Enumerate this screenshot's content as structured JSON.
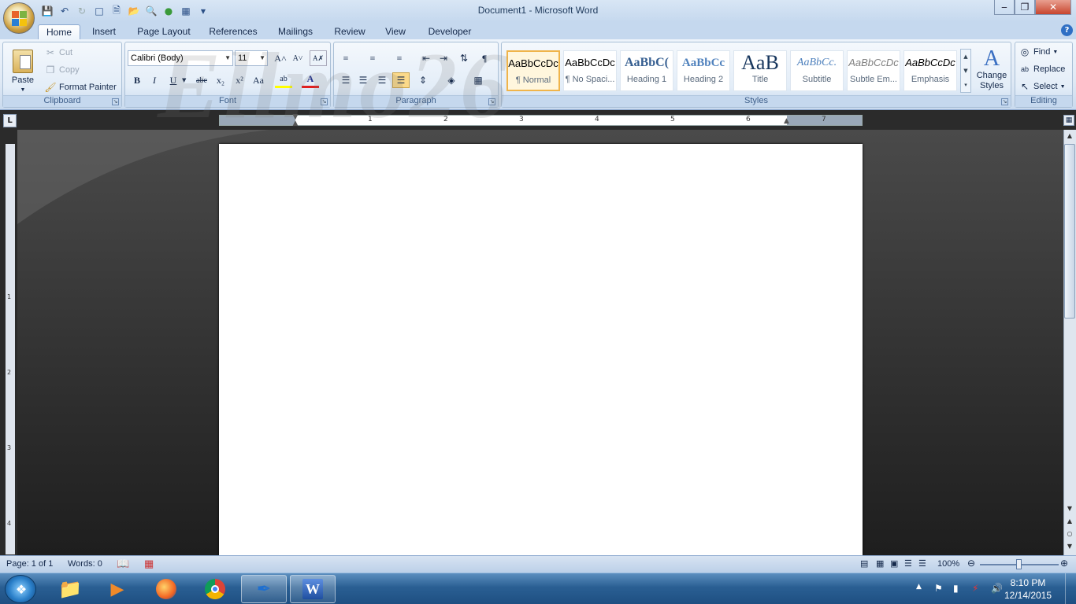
{
  "window": {
    "title": "Document1 - Microsoft Word",
    "minimize": "‒",
    "maximize": "❐",
    "close": "✕",
    "help": "?"
  },
  "tabs": [
    "Home",
    "Insert",
    "Page Layout",
    "References",
    "Mailings",
    "Review",
    "View",
    "Developer"
  ],
  "clipboard": {
    "paste": "Paste",
    "cut": "Cut",
    "copy": "Copy",
    "format_painter": "Format Painter",
    "label": "Clipboard"
  },
  "font": {
    "family": "Calibri (Body)",
    "size": "11",
    "label": "Font",
    "bold": "B",
    "italic": "I",
    "underline": "U",
    "strike": "abe",
    "subscript": "x₂",
    "superscript": "x²",
    "case": "Aa",
    "grow": "A˄",
    "shrink": "A˅",
    "font_color": "A",
    "highlight": "ab"
  },
  "paragraph": {
    "label": "Paragraph",
    "pilcrow": "¶"
  },
  "styles": {
    "label": "Styles",
    "items": [
      {
        "preview": "AaBbCcDc",
        "name": "¶ Normal"
      },
      {
        "preview": "AaBbCcDc",
        "name": "¶ No Spaci..."
      },
      {
        "preview": "AaBbC(",
        "name": "Heading 1"
      },
      {
        "preview": "AaBbCc",
        "name": "Heading 2"
      },
      {
        "preview": "AaB",
        "name": "Title"
      },
      {
        "preview": "AaBbCc.",
        "name": "Subtitle"
      },
      {
        "preview": "AaBbCcDc",
        "name": "Subtle Em..."
      },
      {
        "preview": "AaBbCcDc",
        "name": "Emphasis"
      }
    ],
    "change_styles_line1": "Change",
    "change_styles_line2": "Styles"
  },
  "editing": {
    "label": "Editing",
    "find": "Find",
    "replace": "Replace",
    "select": "Select"
  },
  "ruler": {
    "h_numbers": [
      "1",
      "2",
      "3",
      "4",
      "5",
      "6",
      "7"
    ],
    "v_numbers": [
      "1",
      "2",
      "3",
      "4"
    ],
    "tab_selector": "L"
  },
  "status": {
    "page": "Page: 1 of 1",
    "words": "Words: 0",
    "zoom": "100%"
  },
  "taskbar": {
    "time": "8:10 PM",
    "date": "12/14/2015"
  },
  "watermark": "Ellmo26"
}
